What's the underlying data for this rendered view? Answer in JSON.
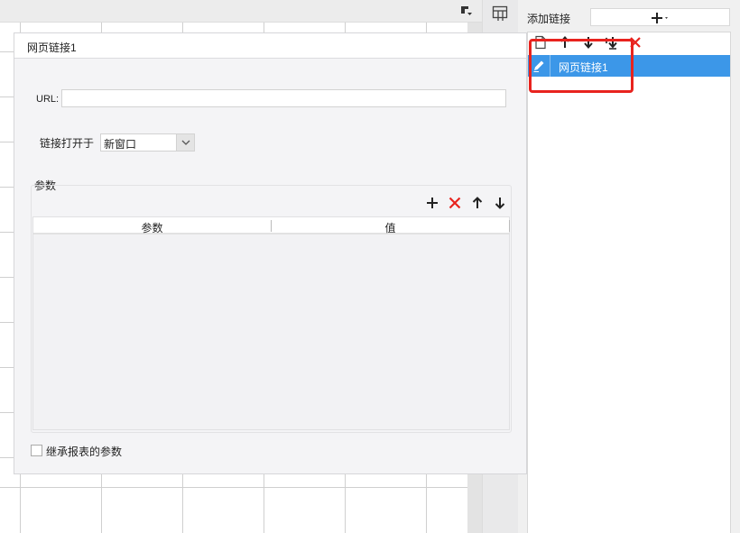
{
  "dialog": {
    "title": "网页链接1",
    "url_label": "URL:",
    "url_value": "",
    "open_label": "链接打开于",
    "open_value": "新窗口",
    "params_label": "参数",
    "table_headers": [
      "参数",
      "值"
    ],
    "inherit_label": "继承报表的参数",
    "inherit_checked": false
  },
  "right_panel": {
    "add_label": "添加链接",
    "items": [
      {
        "label": "网页链接1",
        "selected": true
      }
    ]
  },
  "colors": {
    "accent": "#3c97e8",
    "danger": "#e8231e",
    "highlight_box": "#e8231e"
  },
  "icons": {
    "toolbar_params": [
      "plus-icon",
      "delete-x-icon",
      "arrow-up-icon",
      "arrow-down-icon"
    ],
    "toolbar_links": [
      "new-file-icon",
      "arrow-up-icon",
      "arrow-down-icon",
      "move-bottom-icon",
      "delete-x-icon"
    ],
    "item": "pencil-icon"
  }
}
